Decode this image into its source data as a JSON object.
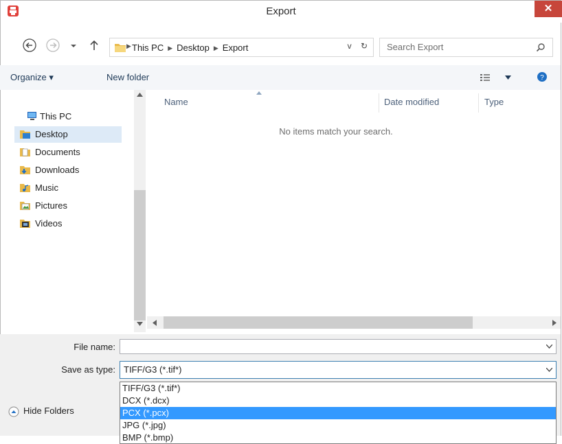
{
  "window": {
    "title": "Export",
    "close_glyph": "✕"
  },
  "address": {
    "breadcrumbs": [
      "This PC",
      "Desktop",
      "Export"
    ],
    "dropdown_glyph": "v",
    "refresh_glyph": "↻"
  },
  "search": {
    "placeholder": "Search Export"
  },
  "toolbar": {
    "organize_label": "Organize ▾",
    "new_folder_label": "New folder"
  },
  "nav_tree": {
    "root": "This PC",
    "items": [
      {
        "label": "Desktop",
        "icon": "desktop-folder-icon",
        "selected": true
      },
      {
        "label": "Documents",
        "icon": "documents-folder-icon",
        "selected": false
      },
      {
        "label": "Downloads",
        "icon": "downloads-folder-icon",
        "selected": false
      },
      {
        "label": "Music",
        "icon": "music-folder-icon",
        "selected": false
      },
      {
        "label": "Pictures",
        "icon": "pictures-folder-icon",
        "selected": false
      },
      {
        "label": "Videos",
        "icon": "videos-folder-icon",
        "selected": false
      }
    ]
  },
  "file_list": {
    "columns": [
      "Name",
      "Date modified",
      "Type"
    ],
    "empty_message": "No items match your search."
  },
  "form": {
    "file_name_label": "File name:",
    "file_name_value": "",
    "save_as_type_label": "Save as type:",
    "save_as_type_value": "TIFF/G3 (*.tif*)",
    "type_options": [
      {
        "label": "TIFF/G3 (*.tif*)",
        "selected": false
      },
      {
        "label": "DCX (*.dcx)",
        "selected": false
      },
      {
        "label": "PCX (*.pcx)",
        "selected": true
      },
      {
        "label": "JPG (*.jpg)",
        "selected": false
      },
      {
        "label": "BMP (*.bmp)",
        "selected": false
      }
    ]
  },
  "hide_folders_label": "Hide Folders",
  "colors": {
    "accent": "#3399ff",
    "close": "#c7463b",
    "selection": "#ddeaf7",
    "toolbar": "#f4f6f9"
  }
}
